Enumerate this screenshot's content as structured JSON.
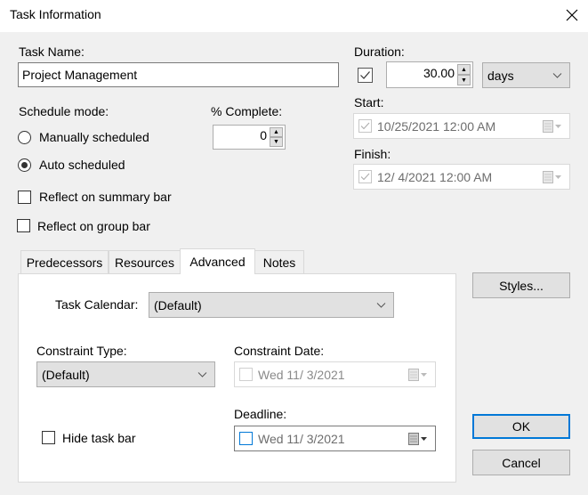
{
  "window": {
    "title": "Task Information",
    "close_icon": "close-icon"
  },
  "task_name": {
    "label": "Task Name:",
    "value": "Project Management"
  },
  "duration": {
    "label": "Duration:",
    "estimated_checked": true,
    "value": "30.00",
    "unit": "days"
  },
  "start": {
    "label": "Start:",
    "value": "10/25/2021 12:00 AM"
  },
  "finish": {
    "label": "Finish:",
    "value": "12/  4/2021 12:00 AM"
  },
  "schedule_mode": {
    "label": "Schedule mode:",
    "options": [
      {
        "label": "Manually scheduled",
        "selected": false
      },
      {
        "label": "Auto scheduled",
        "selected": true
      }
    ]
  },
  "percent_complete": {
    "label": "% Complete:",
    "value": "0"
  },
  "reflect_summary": {
    "label": "Reflect on summary bar",
    "checked": false
  },
  "reflect_group": {
    "label": "Reflect on group bar",
    "checked": false
  },
  "tabs": [
    {
      "label": "Predecessors",
      "active": false
    },
    {
      "label": "Resources",
      "active": false
    },
    {
      "label": "Advanced",
      "active": true
    },
    {
      "label": "Notes",
      "active": false
    }
  ],
  "advanced": {
    "task_calendar_label": "Task Calendar:",
    "task_calendar_value": "(Default)",
    "constraint_type_label": "Constraint Type:",
    "constraint_type_value": "(Default)",
    "constraint_date_label": "Constraint Date:",
    "constraint_date_value": "Wed 11/  3/2021",
    "deadline_label": "Deadline:",
    "deadline_value": "Wed 11/  3/2021",
    "hide_task_bar_label": "Hide task bar",
    "hide_task_bar_checked": false
  },
  "buttons": {
    "styles": "Styles...",
    "ok": "OK",
    "cancel": "Cancel"
  },
  "colors": {
    "accent": "#0078d7",
    "dialog_bg": "#f0f0f0",
    "button_bg": "#e1e1e1"
  }
}
